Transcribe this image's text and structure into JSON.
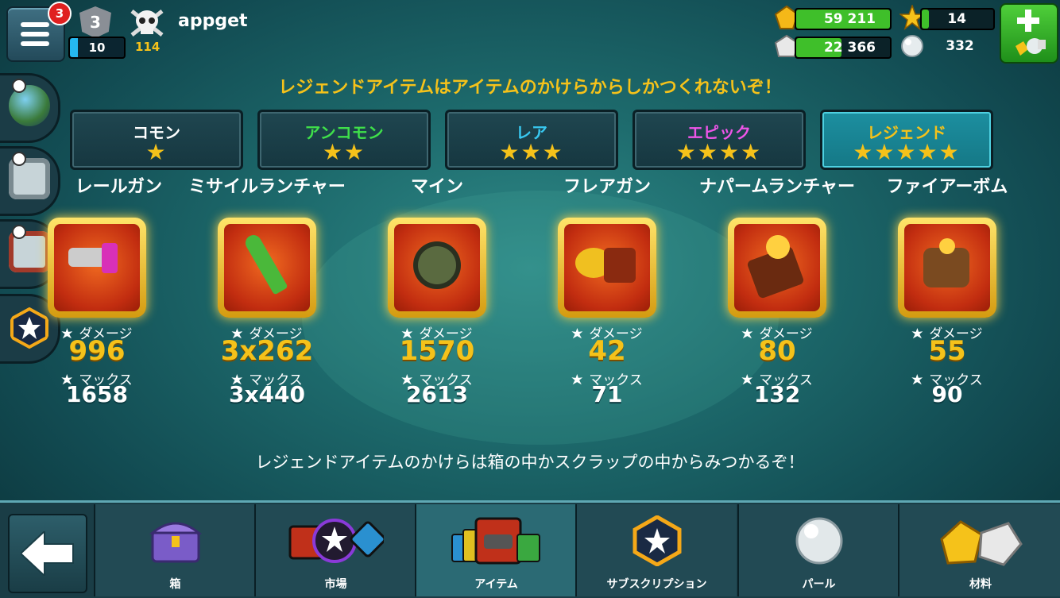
{
  "header": {
    "notification_count": "3",
    "player_level": "3",
    "xp_value": "10",
    "skull_count": "114",
    "username": "appget"
  },
  "resources": {
    "gold": "59 211",
    "silver": "22 366",
    "stars": "14",
    "pearls": "332"
  },
  "banner_top": "レジェンドアイテムはアイテムのかけらからしかつくれないぞ！",
  "tabs": [
    {
      "label": "コモン",
      "stars": "★",
      "color": "#ffffff"
    },
    {
      "label": "アンコモン",
      "stars": "★★",
      "color": "#3fe04a"
    },
    {
      "label": "レア",
      "stars": "★★★",
      "color": "#38c8f0"
    },
    {
      "label": "エピック",
      "stars": "★★★★",
      "color": "#ee55e8"
    },
    {
      "label": "レジェンド",
      "stars": "★★★★★",
      "color": "#f5c21a"
    }
  ],
  "stat_labels": {
    "damage": "ダメージ",
    "max": "マックス"
  },
  "items": [
    {
      "name": "レールガン",
      "damage": "996",
      "max": "1658"
    },
    {
      "name": "ミサイルランチャー",
      "damage": "3x262",
      "max": "3x440"
    },
    {
      "name": "マイン",
      "damage": "1570",
      "max": "2613"
    },
    {
      "name": "フレアガン",
      "damage": "42",
      "max": "71"
    },
    {
      "name": "ナパームランチャー",
      "damage": "80",
      "max": "132"
    },
    {
      "name": "ファイアーボム",
      "damage": "55",
      "max": "90"
    }
  ],
  "banner_bottom": "レジェンドアイテムのかけらは箱の中かスクラップの中からみつかるぞ！",
  "nav": [
    {
      "label": "箱",
      "icon": "chest-icon"
    },
    {
      "label": "市場",
      "icon": "market-icon"
    },
    {
      "label": "アイテム",
      "icon": "items-icon"
    },
    {
      "label": "サブスクリプション",
      "icon": "subscription-star-icon"
    },
    {
      "label": "パール",
      "icon": "pearl-icon"
    },
    {
      "label": "材料",
      "icon": "materials-icon"
    }
  ]
}
